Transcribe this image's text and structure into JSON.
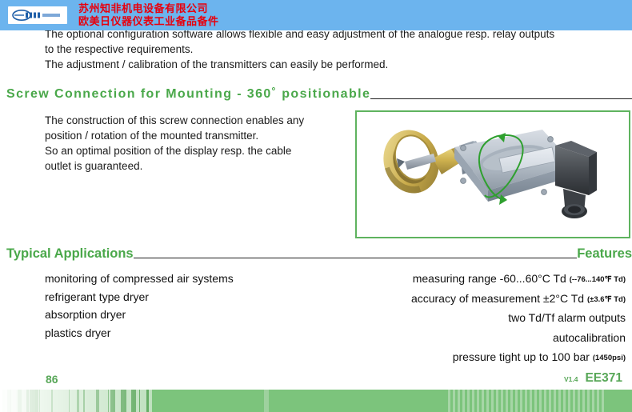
{
  "banner": {
    "logo_icon": "company-oval-logo-icon",
    "line1": "苏州知非机电设备有限公司",
    "line2": "欧美日仪器仪表工业备品备件",
    "bg_color": "#6cb4ee",
    "text_color": "#e8000d"
  },
  "intro": {
    "line1": "The optional configuration software allows flexible and easy adjustment of the analogue resp. relay outputs",
    "line2": "to the respective requirements.",
    "line3": "The adjustment / calibration of the transmitters can easily be performed."
  },
  "screw_section": {
    "heading": "Screw Connection for Mounting - 360˚ positionable",
    "heading_color": "#4aa84a",
    "line1": "The construction of this screw connection enables any",
    "line2": "position / rotation of the mounted transmitter.",
    "line3": "So an optimal position of the display resp. the cable",
    "line4": "outlet is guaranteed.",
    "figure_name": "dew-point-transmitter-rotation-photo",
    "figure_border_color": "#5fb35f"
  },
  "applications": {
    "heading": "Typical Applications",
    "items": [
      "monitoring of compressed air systems",
      "refrigerant type dryer",
      "absorption dryer",
      "plastics dryer"
    ]
  },
  "features": {
    "heading": "Features",
    "items": [
      {
        "main": "measuring range  -60...60°C Td ",
        "sub": "(--76...140℉ Td)"
      },
      {
        "main": "accuracy of measurement ±2°C Td ",
        "sub": "(±3.6℉ Td)"
      },
      {
        "main": "two Td/Tf alarm outputs",
        "sub": ""
      },
      {
        "main": "autocalibration",
        "sub": ""
      },
      {
        "main": "pressure tight up to 100 bar ",
        "sub": "(1450psi)"
      }
    ]
  },
  "footer": {
    "page_number": "86",
    "version": "V1.4",
    "model": "EE371",
    "accent_color": "#58a758",
    "bar_color": "#7cc47c"
  }
}
